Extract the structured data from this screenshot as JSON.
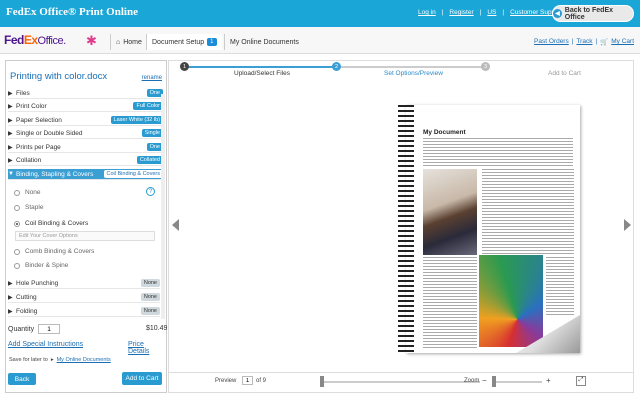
{
  "header": {
    "title": "FedEx Office® Print Online",
    "links": [
      "Log in",
      "Register",
      "US",
      "Customer Support"
    ],
    "back_button": "Back to FedEx Office"
  },
  "nav": {
    "logo_fedex_fe": "Fed",
    "logo_fedex_ex": "Ex",
    "logo_office": "Office.",
    "home": "Home",
    "document_setup": "Document Setup",
    "document_setup_count": "1",
    "online_documents": "My Online Documents",
    "past_orders": "Past Orders",
    "track": "Track",
    "cart": "My Cart"
  },
  "panel": {
    "title": "Printing with color.docx",
    "rename": "rename",
    "options": [
      {
        "label": "Files",
        "value": "One"
      },
      {
        "label": "Print Color",
        "value": "Full Color"
      },
      {
        "label": "Paper Selection",
        "value": "Laser White (32 lb)"
      },
      {
        "label": "Single or Double Sided",
        "value": "Single"
      },
      {
        "label": "Prints per Page",
        "value": "One"
      },
      {
        "label": "Collation",
        "value": "Collated"
      },
      {
        "label": "Binding, Stapling & Covers",
        "value": "Coil Binding & Covers"
      }
    ],
    "binding_choices": [
      "None",
      "Staple",
      "Coil Binding & Covers",
      "Comb Binding & Covers",
      "Binder & Spine"
    ],
    "cover_options": "Edit Your Cover Options",
    "more_options": [
      {
        "label": "Hole Punching",
        "value": "None"
      },
      {
        "label": "Cutting",
        "value": "None"
      },
      {
        "label": "Folding",
        "value": "None"
      }
    ],
    "quantity_label": "Quantity",
    "quantity_value": "1",
    "price": "$10.49",
    "special_instructions": "Add Special Instructions",
    "price_details": "Price Details",
    "save_later": "Save for later to",
    "save_later_link": "My Online Documents",
    "back": "Back",
    "add_to_cart": "Add to Cart"
  },
  "steps": [
    {
      "num": "1",
      "label": "Upload/Select Files"
    },
    {
      "num": "2",
      "label": "Set Options/Preview"
    },
    {
      "num": "3",
      "label": "Add to Cart"
    }
  ],
  "preview": {
    "doc_heading": "My Document",
    "page_label": "Preview",
    "page_value": "1",
    "page_total": "of 9",
    "zoom_label": "Zoom",
    "fullscreen": "⤢"
  },
  "colors": {
    "brand_blue": "#1aa6d6",
    "button_blue": "#2a9bd0",
    "link_blue": "#1a6fb5"
  }
}
